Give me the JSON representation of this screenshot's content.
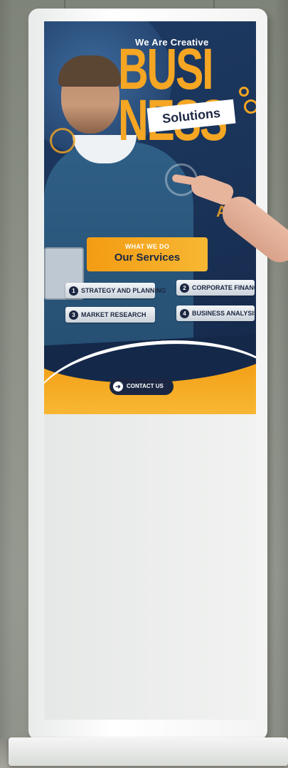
{
  "screen": {
    "tagline": "We Are Creative",
    "headline_line1": "BUSI",
    "headline_line2": "NESS",
    "solutions_label": "Solutions",
    "agency_label": "AGENCY",
    "services_kicker": "WHAT WE DO",
    "services_title": "Our Services",
    "services": [
      {
        "num": "1",
        "label": "STRATEGY AND PLANNING"
      },
      {
        "num": "2",
        "label": "CORPORATE FINANCE"
      },
      {
        "num": "3",
        "label": "MARKET RESEARCH"
      },
      {
        "num": "4",
        "label": "BUSINESS ANALYSIS"
      }
    ],
    "contact_label": "CONTACT US"
  },
  "colors": {
    "accent": "#f5a623",
    "navy": "#1b2742",
    "kiosk_white": "#f3f4f3"
  },
  "icons": {
    "contact": "arrow-right-icon"
  }
}
